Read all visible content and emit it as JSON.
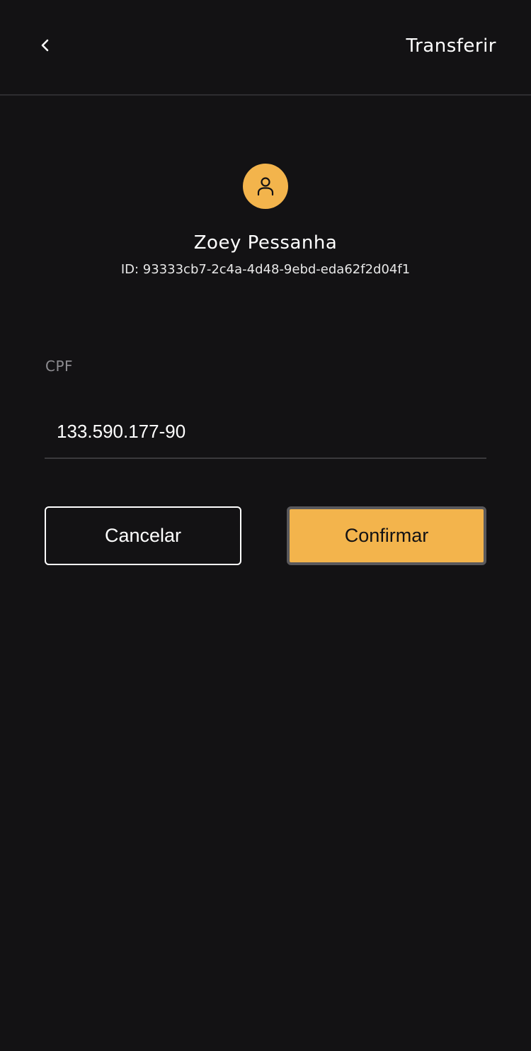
{
  "header": {
    "back_icon": "chevron-left-icon",
    "title": "Transferir"
  },
  "recipient": {
    "avatar_icon": "user-icon",
    "name": "Zoey Pessanha",
    "id_text": "ID: 93333cb7-2c4a-4d48-9ebd-eda62f2d04f1"
  },
  "form": {
    "cpf_label": "CPF",
    "cpf_value": "133.590.177-90"
  },
  "actions": {
    "cancel_label": "Cancelar",
    "confirm_label": "Confirmar"
  },
  "colors": {
    "background": "#131214",
    "accent": "#f3b44c",
    "divider": "#2e2d30",
    "label_muted": "#8d8c90"
  }
}
